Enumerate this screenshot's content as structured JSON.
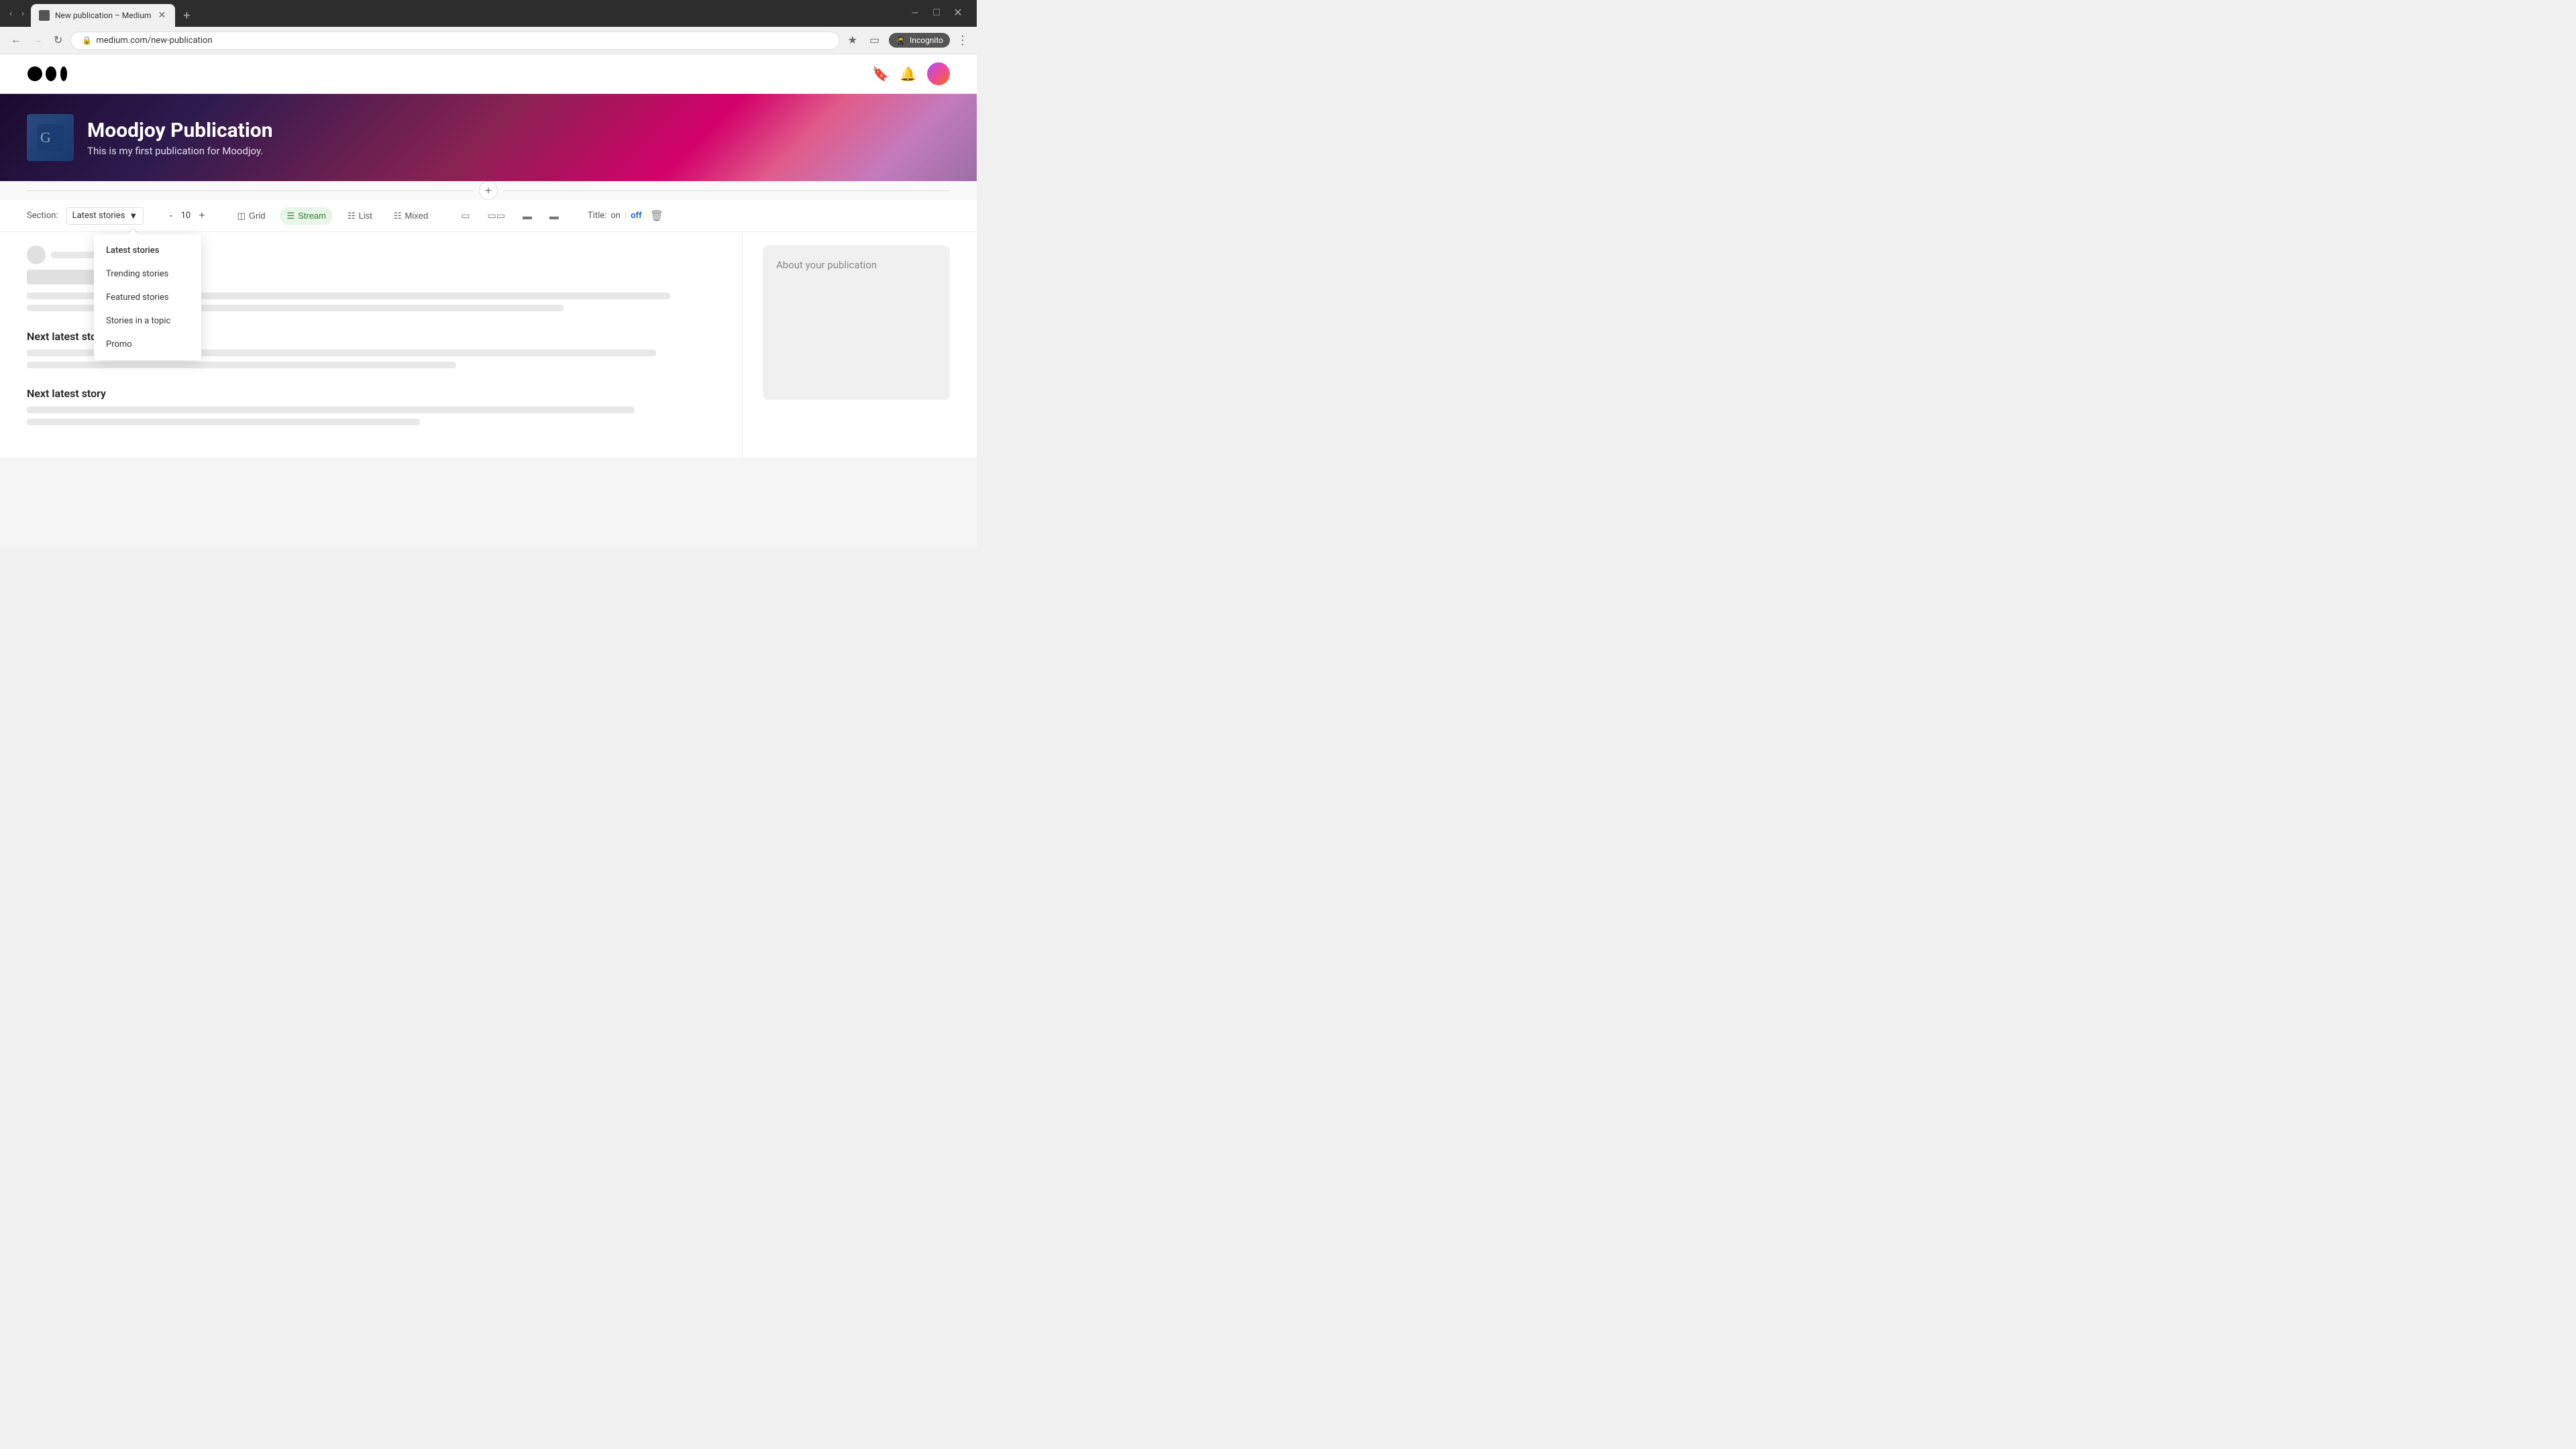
{
  "browser": {
    "tab_title": "New publication – Medium",
    "tab_favicon": "M",
    "address": "medium.com/new-publication",
    "new_tab_label": "+",
    "incognito_label": "Incognito",
    "back_disabled": false,
    "forward_disabled": true
  },
  "header": {
    "logo_alt": "Medium",
    "bookmark_icon": "bookmark",
    "bell_icon": "bell",
    "avatar_alt": "user avatar"
  },
  "hero": {
    "publication_name": "Moodjoy Publication",
    "publication_desc": "This is my first publication for Moodjoy."
  },
  "toolbar": {
    "section_label": "Section:",
    "section_value": "Latest stories",
    "count": "10",
    "count_minus": "-",
    "count_plus": "+",
    "view_grid": "Grid",
    "view_stream": "Stream",
    "view_list": "List",
    "view_mixed": "Mixed",
    "title_label": "Title:",
    "title_on": "on",
    "title_separator": "|",
    "title_off": "off"
  },
  "dropdown": {
    "arrow_offset": "50px",
    "items": [
      {
        "label": "Latest stories",
        "active": true
      },
      {
        "label": "Trending stories",
        "active": false
      },
      {
        "label": "Featured stories",
        "active": false
      },
      {
        "label": "Stories in a topic",
        "active": false
      },
      {
        "label": "Promo",
        "active": false
      }
    ]
  },
  "content": {
    "next_story_label": "Next latest story",
    "about_pub_label": "About your publication"
  },
  "add_section": {
    "plus_icon": "+"
  }
}
